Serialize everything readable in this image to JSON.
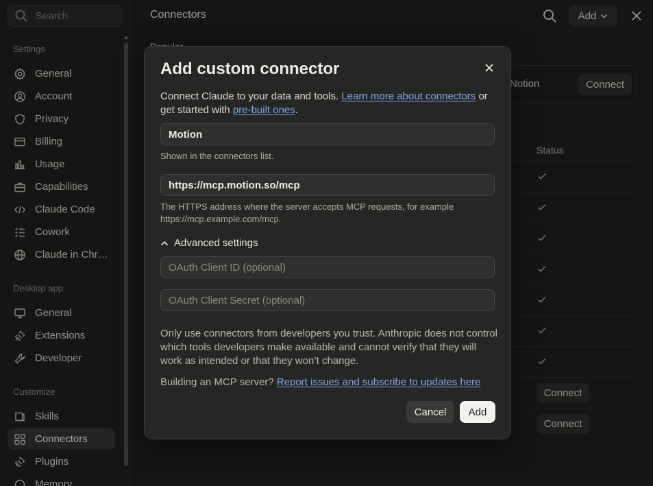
{
  "sidebar": {
    "search_placeholder": "Search",
    "sections": {
      "settings": "Settings",
      "desktop_app": "Desktop app",
      "customize": "Customize"
    },
    "settings_items": [
      {
        "label": "General",
        "icon": "gear-icon"
      },
      {
        "label": "Account",
        "icon": "account-circle-icon"
      },
      {
        "label": "Privacy",
        "icon": "shield-icon"
      },
      {
        "label": "Billing",
        "icon": "card-icon"
      },
      {
        "label": "Usage",
        "icon": "bar-chart-icon"
      },
      {
        "label": "Capabilities",
        "icon": "briefcase-icon"
      },
      {
        "label": "Claude Code",
        "icon": "code-icon"
      },
      {
        "label": "Cowork",
        "icon": "list-icon"
      },
      {
        "label": "Claude in Chr…",
        "icon": "globe-icon"
      }
    ],
    "desktop_items": [
      {
        "label": "General",
        "icon": "monitor-icon"
      },
      {
        "label": "Extensions",
        "icon": "puzzle-icon"
      },
      {
        "label": "Developer",
        "icon": "wrench-icon"
      }
    ],
    "customize_items": [
      {
        "label": "Skills",
        "icon": "skills-icon"
      },
      {
        "label": "Connectors",
        "icon": "connectors-icon",
        "active": true
      },
      {
        "label": "Plugins",
        "icon": "plugin-icon"
      },
      {
        "label": "Memory",
        "icon": "memory-icon"
      }
    ]
  },
  "header": {
    "title": "Connectors",
    "add_label": "Add"
  },
  "main": {
    "popular_label": "Popular",
    "popular_card_name": "Notion",
    "popular_card_button": "Connect",
    "status_header": "Status",
    "connect_label": "Connect"
  },
  "modal": {
    "title": "Add custom connector",
    "intro_text_1": "Connect Claude to your data and tools. ",
    "intro_link_1": "Learn more about connectors",
    "intro_text_2": " or get started with ",
    "intro_link_2": "pre-built ones",
    "intro_text_3": ".",
    "name_value": "Motion",
    "name_hint": "Shown in the connectors list.",
    "url_value": "https://mcp.motion.so/mcp",
    "url_hint": "The HTTPS address where the server accepts MCP requests, for example https://mcp.example.com/mcp.",
    "advanced_label": "Advanced settings",
    "client_id_placeholder": "OAuth Client ID (optional)",
    "client_secret_placeholder": "OAuth Client Secret (optional)",
    "warning": "Only use connectors from developers you trust. Anthropic does not control which tools developers make available and cannot verify that they will work as intended or that they won’t change.",
    "mcp_text": "Building an MCP server? ",
    "mcp_link": "Report issues and subscribe to updates here",
    "cancel_label": "Cancel",
    "add_label": "Add"
  }
}
